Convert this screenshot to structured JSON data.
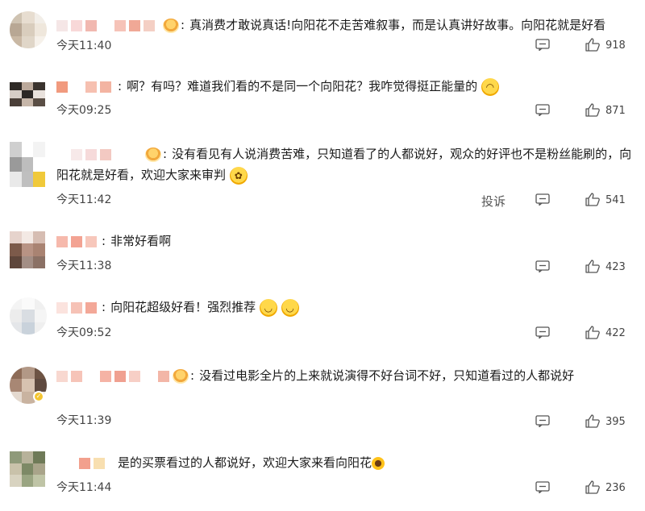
{
  "comments": [
    {
      "text": "真消费才敢说真话!向阳花不走苦难叙事，而是认真讲好故事。向阳花就是好看",
      "time": "今天11:40",
      "likes": "918",
      "avatar_colors": [
        "#cfc3b2",
        "#e7ddd0",
        "#f2eee8",
        "#b8a794",
        "#d9cdbd",
        "#efe7dc",
        "#c9b8a4",
        "#e0d6c8",
        "#f6f1ea"
      ],
      "name_colors": [
        "#f5e6e6",
        "#f8d8d8",
        "#f1b8b0",
        "#ffffff",
        "#f6c3b8",
        "#f0a896",
        "#f4cfc4"
      ]
    },
    {
      "text": "啊？有吗？难道我们看的不是同一个向阳花？我咋觉得挺正能量的",
      "time": "今天09:25",
      "likes": "871",
      "avatar_colors": [
        "#2f2a26",
        "#bba99b",
        "#3a332e",
        "#d6cdc6",
        "#2b2725",
        "#e8e1dc",
        "#4a3f38",
        "#c6b6a9",
        "#5a4e45"
      ],
      "name_colors": [
        "#f19a7e",
        "#ffffff",
        "#f6c0b0",
        "#f3b4a2"
      ]
    },
    {
      "text": "没有看见有人说消费苦难，只知道看了的人都说好，观众的好评也不是粉丝能刷的，向阳花就是好看，欢迎大家来审判",
      "time": "今天11:42",
      "likes": "541",
      "report": "投诉",
      "avatar_colors": [
        "#cfcfcf",
        "#ffffff",
        "#f3f3f3",
        "#9a9a9a",
        "#bdbdbd",
        "#ffffff",
        "#e9e9e9",
        "#bfbfbf",
        "#f0c93a"
      ],
      "name_colors": [
        "#ffffff",
        "#f7e9e9",
        "#f6dada",
        "#f3c9c2"
      ]
    },
    {
      "text": "非常好看啊",
      "time": "今天11:38",
      "likes": "423",
      "avatar_colors": [
        "#e6d3cc",
        "#f3e9e4",
        "#d6bdb2",
        "#7c5a4a",
        "#b89384",
        "#a98372",
        "#5e463b",
        "#a38e85",
        "#8b7165"
      ],
      "name_colors": [
        "#f6b9ac",
        "#f3a393",
        "#f7c7bb"
      ]
    },
    {
      "text": "向阳花超级好看！强烈推荐",
      "time": "今天09:52",
      "likes": "422",
      "avatar_colors": [
        "#f4f4f4",
        "#fafafa",
        "#f0f0f0",
        "#ececec",
        "#d9dde2",
        "#f5f5f5",
        "#e4e6e9",
        "#c9d2db",
        "#efefef"
      ],
      "name_colors": [
        "#fbe3de",
        "#f6c2b6",
        "#f3a898"
      ]
    },
    {
      "text": "没看过电影全片的上来就说演得不好台词不好，只知道看过的人都说好",
      "time": "今天11:39",
      "likes": "395",
      "avatar_colors": [
        "#8d6b57",
        "#b29886",
        "#6e5444",
        "#a88774",
        "#d7c2b0",
        "#5f4a3f",
        "#e4d9cf",
        "#c9b3a0",
        "#f0e8e0"
      ],
      "name_colors": [
        "#f8d8d0",
        "#f6c4b8",
        "#ffffff",
        "#f5b3a5",
        "#f0a090",
        "#f7cfc6",
        "#ffffff",
        "#f3b6a7"
      ]
    },
    {
      "text": "是的买票看过的人都说好，欢迎大家来看向阳花",
      "time": "今天11:44",
      "likes": "236",
      "avatar_colors": [
        "#8f9a7a",
        "#b7b29a",
        "#6f7a58",
        "#c9c2aa",
        "#7d8966",
        "#a9a48a",
        "#d8d3c0",
        "#9aa582",
        "#bfc4a6"
      ],
      "name_colors": [
        "#f2a08d",
        "#f8dfb0"
      ]
    }
  ],
  "icons": {
    "reply": "comment-icon",
    "like": "thumbs-up-icon",
    "report": "report-link"
  },
  "emoji_meta": {
    "c2": "grinning-face-emoji",
    "c3": "party-face-emoji",
    "c5": "hug-face-emoji",
    "c7": "sunflower-emoji"
  }
}
